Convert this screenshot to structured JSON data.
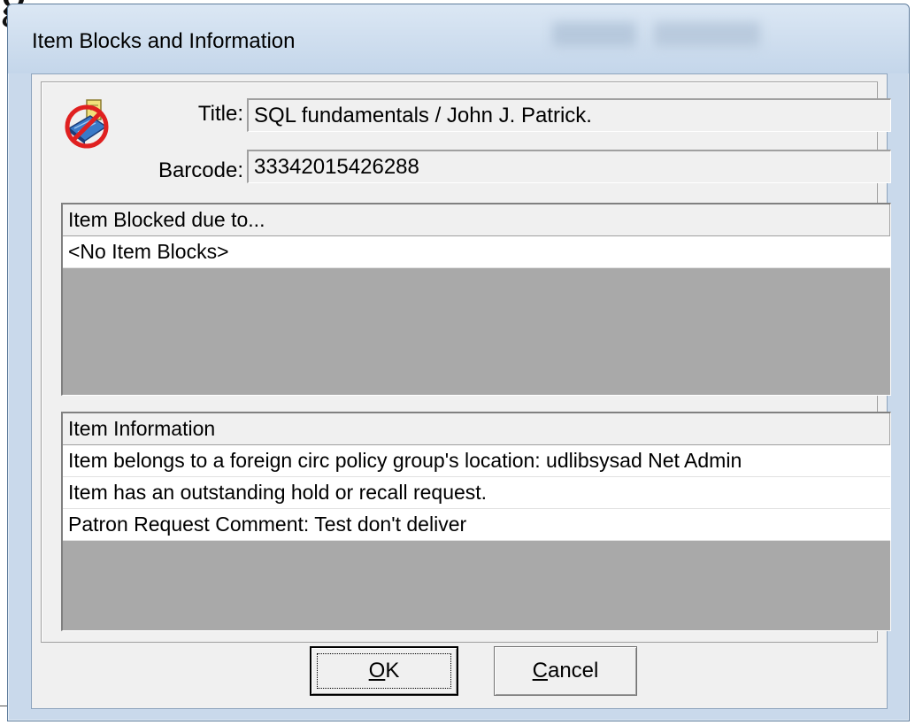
{
  "window": {
    "title": "Item Blocks and Information"
  },
  "icon": {
    "name": "blocked-item-icon"
  },
  "fields": {
    "title_label": "Title:",
    "title_value": "SQL fundamentals / John J. Patrick.",
    "barcode_label": "Barcode:",
    "barcode_value": "33342015426288"
  },
  "blocks_list": {
    "header": "Item Blocked due to...",
    "rows": [
      "<No Item Blocks>"
    ]
  },
  "info_list": {
    "header": "Item Information",
    "rows": [
      "Item belongs to a foreign circ policy group's location:  udlibsysad Net Admin",
      "Item has an outstanding hold or recall request.",
      "Patron Request Comment:  Test don't deliver"
    ]
  },
  "buttons": {
    "ok_mnemonic": "O",
    "ok_rest": "K",
    "cancel_mnemonic": "C",
    "cancel_rest": "ancel"
  }
}
